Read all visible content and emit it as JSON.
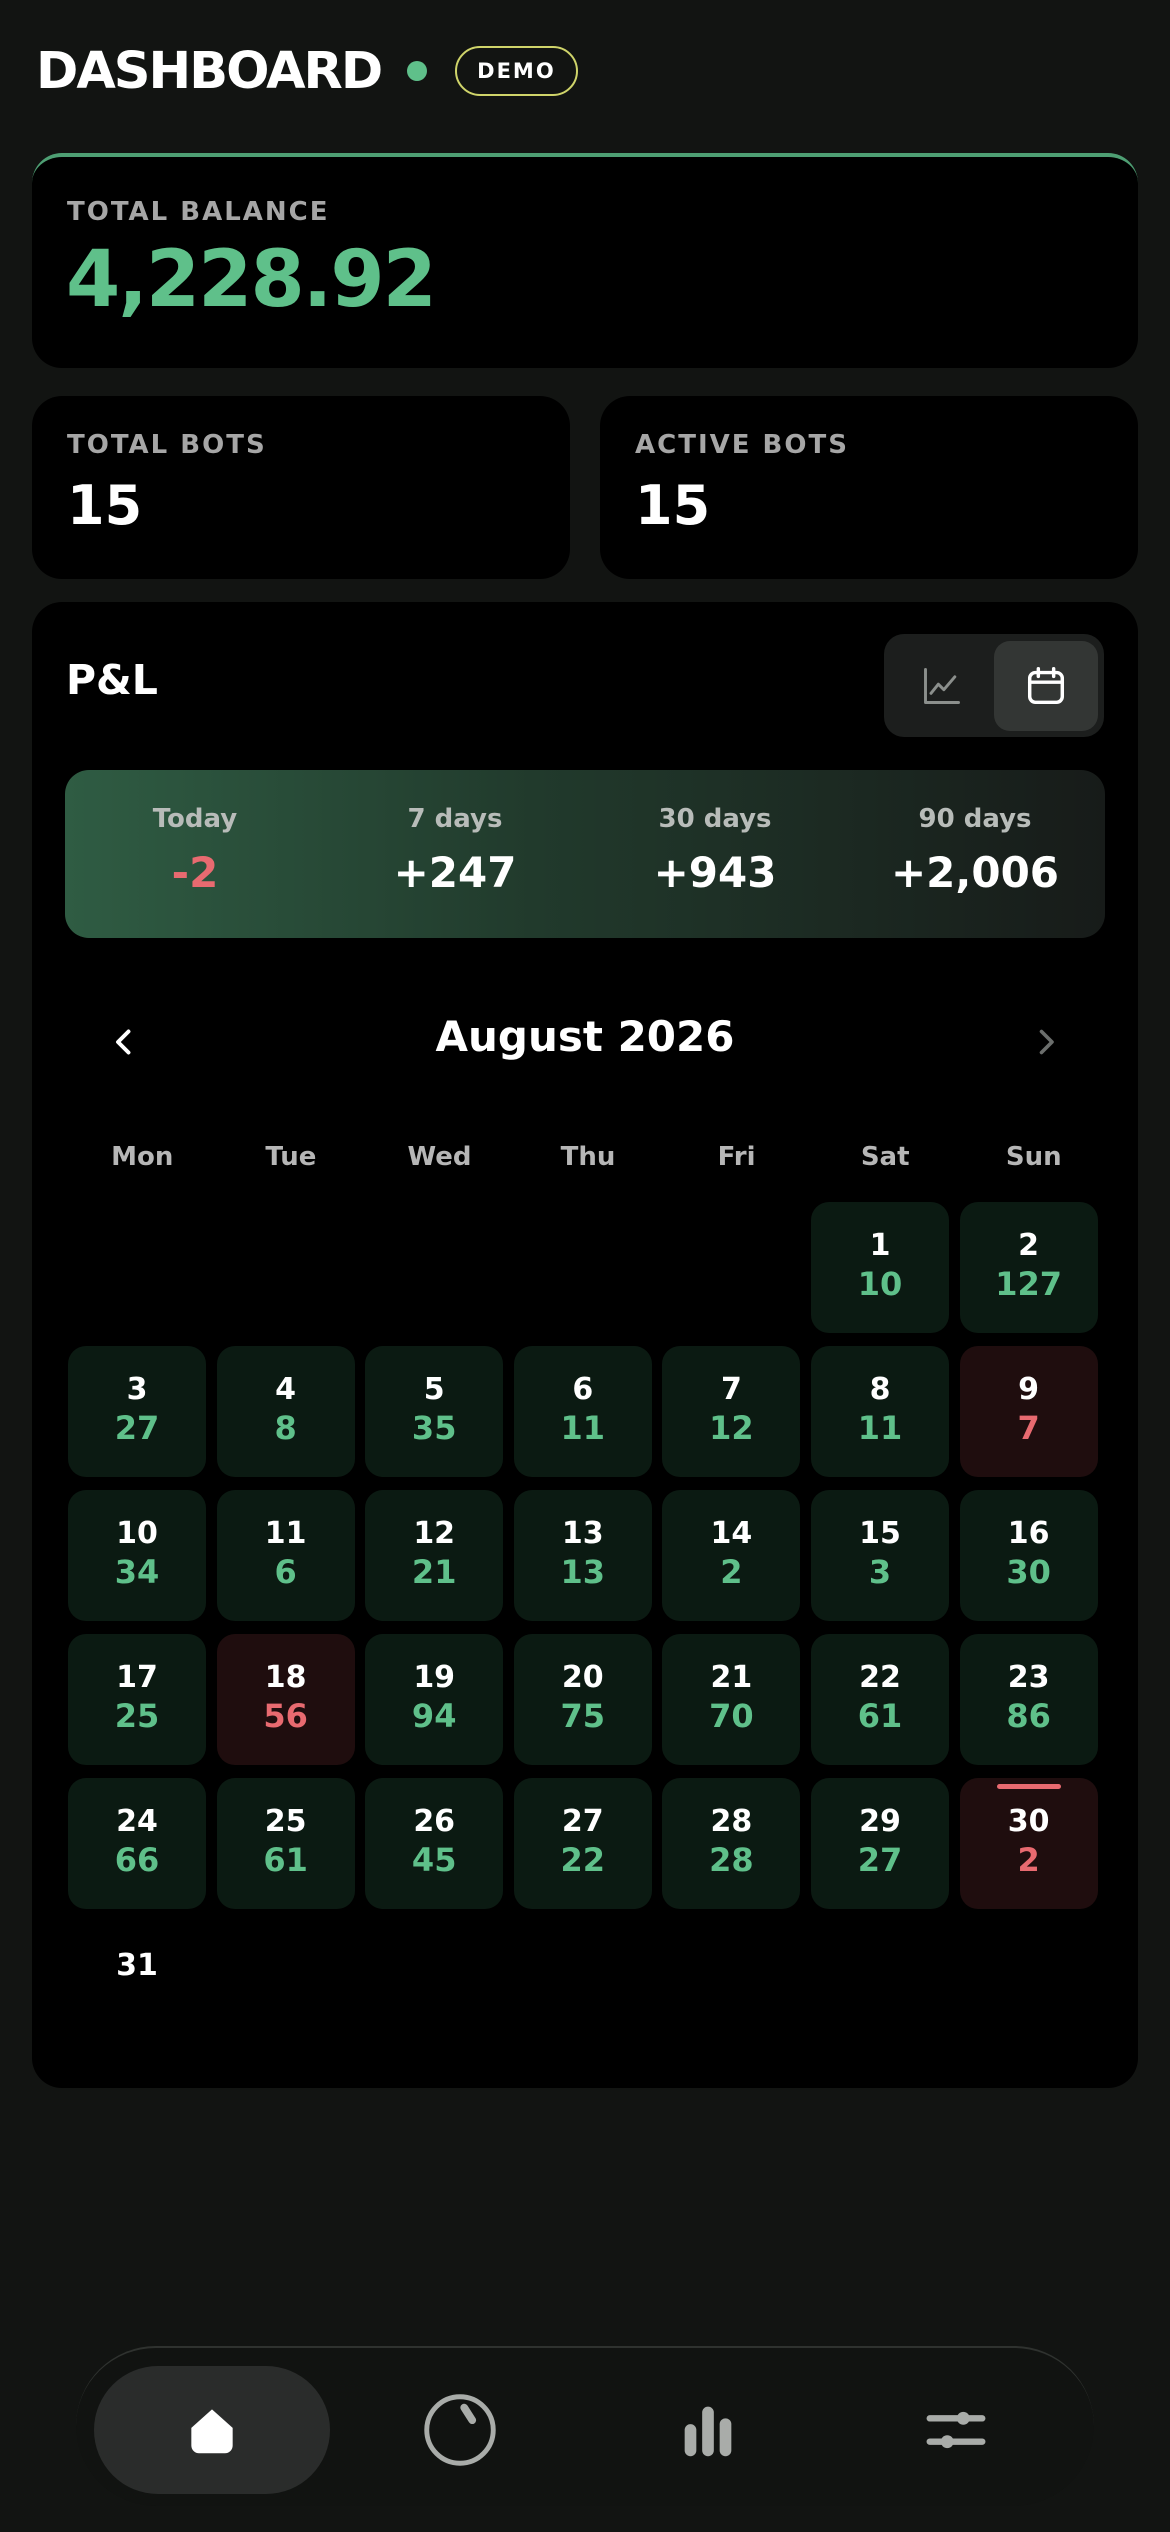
{
  "header": {
    "title": "DASHBOARD",
    "badge": "DEMO"
  },
  "balance": {
    "label": "TOTAL BALANCE",
    "value": "4,228.92"
  },
  "stats": [
    {
      "label": "TOTAL BOTS",
      "value": "15"
    },
    {
      "label": "ACTIVE BOTS",
      "value": "15"
    }
  ],
  "pl": {
    "title": "P&L",
    "view_options": [
      "chart",
      "calendar"
    ],
    "active_view": "calendar",
    "summary": [
      {
        "label": "Today",
        "value": "-2",
        "status": "negative"
      },
      {
        "label": "7 days",
        "value": "+247",
        "status": "positive"
      },
      {
        "label": "30 days",
        "value": "+943",
        "status": "positive"
      },
      {
        "label": "90 days",
        "value": "+2,006",
        "status": "positive"
      }
    ],
    "calendar": {
      "month": "August 2026",
      "weekdays": [
        "Mon",
        "Tue",
        "Wed",
        "Thu",
        "Fri",
        "Sat",
        "Sun"
      ],
      "first_weekday_index": 5,
      "today": 30,
      "days": [
        {
          "day": "1",
          "value": "10",
          "status": "profit"
        },
        {
          "day": "2",
          "value": "127",
          "status": "profit"
        },
        {
          "day": "3",
          "value": "27",
          "status": "profit"
        },
        {
          "day": "4",
          "value": "8",
          "status": "profit"
        },
        {
          "day": "5",
          "value": "35",
          "status": "profit"
        },
        {
          "day": "6",
          "value": "11",
          "status": "profit"
        },
        {
          "day": "7",
          "value": "12",
          "status": "profit"
        },
        {
          "day": "8",
          "value": "11",
          "status": "profit"
        },
        {
          "day": "9",
          "value": "7",
          "status": "loss"
        },
        {
          "day": "10",
          "value": "34",
          "status": "profit"
        },
        {
          "day": "11",
          "value": "6",
          "status": "profit"
        },
        {
          "day": "12",
          "value": "21",
          "status": "profit"
        },
        {
          "day": "13",
          "value": "13",
          "status": "profit"
        },
        {
          "day": "14",
          "value": "2",
          "status": "profit"
        },
        {
          "day": "15",
          "value": "3",
          "status": "profit"
        },
        {
          "day": "16",
          "value": "30",
          "status": "profit"
        },
        {
          "day": "17",
          "value": "25",
          "status": "profit"
        },
        {
          "day": "18",
          "value": "56",
          "status": "loss"
        },
        {
          "day": "19",
          "value": "94",
          "status": "profit"
        },
        {
          "day": "20",
          "value": "75",
          "status": "profit"
        },
        {
          "day": "21",
          "value": "70",
          "status": "profit"
        },
        {
          "day": "22",
          "value": "61",
          "status": "profit"
        },
        {
          "day": "23",
          "value": "86",
          "status": "profit"
        },
        {
          "day": "24",
          "value": "66",
          "status": "profit"
        },
        {
          "day": "25",
          "value": "61",
          "status": "profit"
        },
        {
          "day": "26",
          "value": "45",
          "status": "profit"
        },
        {
          "day": "27",
          "value": "22",
          "status": "profit"
        },
        {
          "day": "28",
          "value": "28",
          "status": "profit"
        },
        {
          "day": "29",
          "value": "27",
          "status": "profit"
        },
        {
          "day": "30",
          "value": "2",
          "status": "loss"
        },
        {
          "day": "31",
          "value": "",
          "status": "none"
        }
      ]
    }
  },
  "bottom_nav": {
    "items": [
      {
        "icon": "home-icon"
      },
      {
        "icon": "gauge-icon"
      },
      {
        "icon": "bar-chart-icon"
      },
      {
        "icon": "sliders-icon"
      }
    ],
    "active_index": 0
  },
  "colors": {
    "positive": "#5fc08a",
    "negative": "#e86a70",
    "background": "#121412",
    "card": "#000000"
  }
}
